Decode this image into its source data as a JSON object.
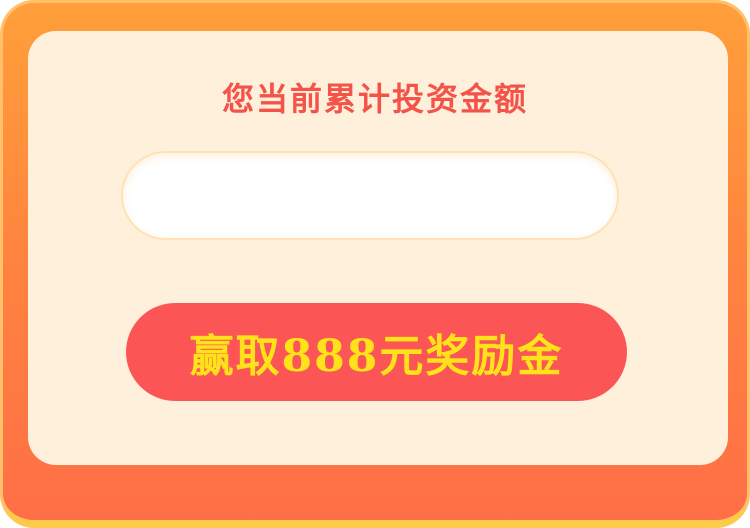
{
  "form": {
    "title": "您当前累计投资金额",
    "amount_value": "",
    "amount_placeholder": ""
  },
  "cta": {
    "label": "赢取888元奖励金"
  },
  "colors": {
    "frame_top": "#ff9f3a",
    "frame_bottom": "#ff6f47",
    "card_background": "#fff0db",
    "title_text": "#f4534a",
    "button_background": "#fb5655",
    "button_text": "#ffe21a"
  }
}
